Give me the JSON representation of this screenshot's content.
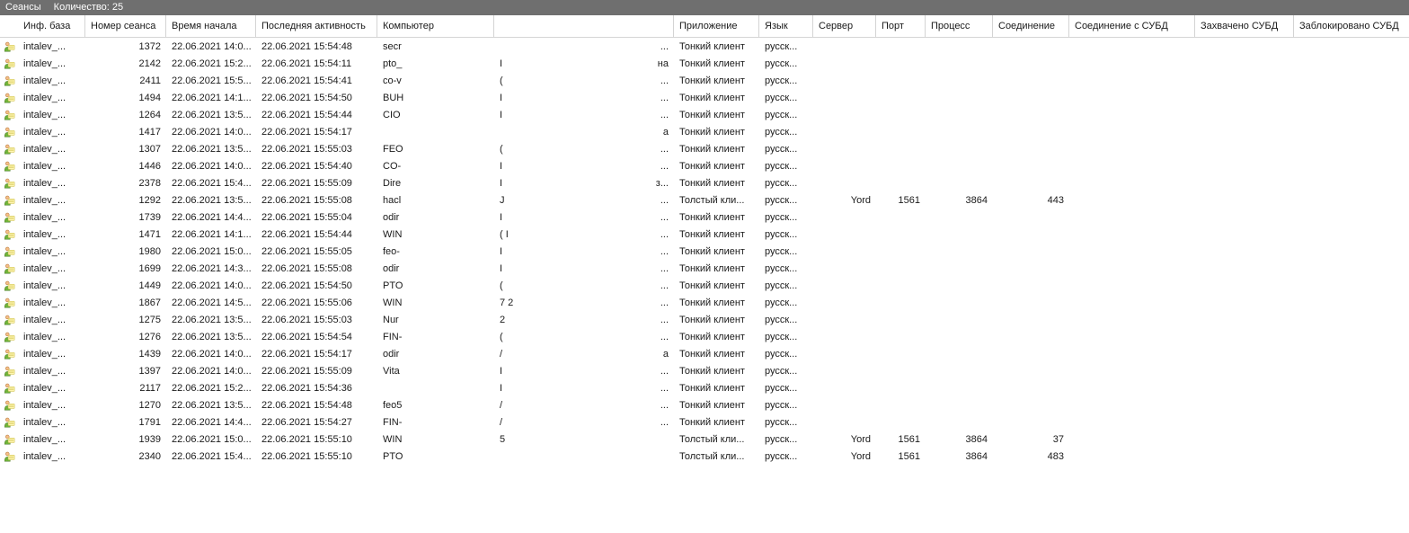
{
  "titlebar": {
    "title": "Сеансы",
    "count_label": "Количество: 25"
  },
  "headers": {
    "ib": "Инф. база",
    "num": "Номер сеанса",
    "start": "Время начала",
    "last": "Последняя активность",
    "comp": "Компьютер",
    "gap": "",
    "app": "Приложение",
    "lang": "Язык",
    "srv": "Сервер",
    "port": "Порт",
    "proc": "Процесс",
    "conn": "Соединение",
    "connd": "Соединение с СУБД",
    "zah": "Захвачено СУБД",
    "blk": "Заблокировано СУБД"
  },
  "rows": [
    {
      "ib": "intalev_...",
      "num": "1372",
      "start": "22.06.2021 14:0...",
      "last": "22.06.2021 15:54:48",
      "comp": "secr",
      "g": "",
      "gt": "...",
      "app": "Тонкий клиент",
      "lang": "русск...",
      "srv": "",
      "port": "",
      "proc": "",
      "conn": ""
    },
    {
      "ib": "intalev_...",
      "num": "2142",
      "start": "22.06.2021 15:2...",
      "last": "22.06.2021 15:54:11",
      "comp": "pto_",
      "g": "I",
      "gt": "на",
      "app": "Тонкий клиент",
      "lang": "русск...",
      "srv": "",
      "port": "",
      "proc": "",
      "conn": ""
    },
    {
      "ib": "intalev_...",
      "num": "2411",
      "start": "22.06.2021 15:5...",
      "last": "22.06.2021 15:54:41",
      "comp": "co-v",
      "g": "(",
      "gt": "...",
      "app": "Тонкий клиент",
      "lang": "русск...",
      "srv": "",
      "port": "",
      "proc": "",
      "conn": ""
    },
    {
      "ib": "intalev_...",
      "num": "1494",
      "start": "22.06.2021 14:1...",
      "last": "22.06.2021 15:54:50",
      "comp": "BUH",
      "g": "I",
      "gt": "...",
      "app": "Тонкий клиент",
      "lang": "русск...",
      "srv": "",
      "port": "",
      "proc": "",
      "conn": ""
    },
    {
      "ib": "intalev_...",
      "num": "1264",
      "start": "22.06.2021 13:5...",
      "last": "22.06.2021 15:54:44",
      "comp": "CIO",
      "g": "I",
      "gt": "...",
      "app": "Тонкий клиент",
      "lang": "русск...",
      "srv": "",
      "port": "",
      "proc": "",
      "conn": ""
    },
    {
      "ib": "intalev_...",
      "num": "1417",
      "start": "22.06.2021 14:0...",
      "last": "22.06.2021 15:54:17",
      "comp": "",
      "g": "",
      "gt": "а",
      "app": "Тонкий клиент",
      "lang": "русск...",
      "srv": "",
      "port": "",
      "proc": "",
      "conn": ""
    },
    {
      "ib": "intalev_...",
      "num": "1307",
      "start": "22.06.2021 13:5...",
      "last": "22.06.2021 15:55:03",
      "comp": "FEO",
      "g": "(",
      "gt": "...",
      "app": "Тонкий клиент",
      "lang": "русск...",
      "srv": "",
      "port": "",
      "proc": "",
      "conn": ""
    },
    {
      "ib": "intalev_...",
      "num": "1446",
      "start": "22.06.2021 14:0...",
      "last": "22.06.2021 15:54:40",
      "comp": "CO-",
      "g": "I",
      "gt": "...",
      "app": "Тонкий клиент",
      "lang": "русск...",
      "srv": "",
      "port": "",
      "proc": "",
      "conn": ""
    },
    {
      "ib": "intalev_...",
      "num": "2378",
      "start": "22.06.2021 15:4...",
      "last": "22.06.2021 15:55:09",
      "comp": "Dire",
      "g": "I",
      "gt": "з...",
      "app": "Тонкий клиент",
      "lang": "русск...",
      "srv": "",
      "port": "",
      "proc": "",
      "conn": ""
    },
    {
      "ib": "intalev_...",
      "num": "1292",
      "start": "22.06.2021 13:5...",
      "last": "22.06.2021 15:55:08",
      "comp": "hacl",
      "g": "J",
      "gt": "...",
      "app": "Толстый кли...",
      "lang": "русск...",
      "srv": "Yord",
      "port": "1561",
      "proc": "3864",
      "conn": "443"
    },
    {
      "ib": "intalev_...",
      "num": "1739",
      "start": "22.06.2021 14:4...",
      "last": "22.06.2021 15:55:04",
      "comp": "odir",
      "g": "I",
      "gt": "...",
      "app": "Тонкий клиент",
      "lang": "русск...",
      "srv": "",
      "port": "",
      "proc": "",
      "conn": ""
    },
    {
      "ib": "intalev_...",
      "num": "1471",
      "start": "22.06.2021 14:1...",
      "last": "22.06.2021 15:54:44",
      "comp": "WIN",
      "g": "(   I",
      "gt": "...",
      "app": "Тонкий клиент",
      "lang": "русск...",
      "srv": "",
      "port": "",
      "proc": "",
      "conn": ""
    },
    {
      "ib": "intalev_...",
      "num": "1980",
      "start": "22.06.2021 15:0...",
      "last": "22.06.2021 15:55:05",
      "comp": "feo-",
      "g": "I",
      "gt": "...",
      "app": "Тонкий клиент",
      "lang": "русск...",
      "srv": "",
      "port": "",
      "proc": "",
      "conn": ""
    },
    {
      "ib": "intalev_...",
      "num": "1699",
      "start": "22.06.2021 14:3...",
      "last": "22.06.2021 15:55:08",
      "comp": "odir",
      "g": "I",
      "gt": "...",
      "app": "Тонкий клиент",
      "lang": "русск...",
      "srv": "",
      "port": "",
      "proc": "",
      "conn": ""
    },
    {
      "ib": "intalev_...",
      "num": "1449",
      "start": "22.06.2021 14:0...",
      "last": "22.06.2021 15:54:50",
      "comp": "PTO",
      "g": "(",
      "gt": "...",
      "app": "Тонкий клиент",
      "lang": "русск...",
      "srv": "",
      "port": "",
      "proc": "",
      "conn": ""
    },
    {
      "ib": "intalev_...",
      "num": "1867",
      "start": "22.06.2021 14:5...",
      "last": "22.06.2021 15:55:06",
      "comp": "WIN",
      "g": "7   2",
      "gt": "...",
      "app": "Тонкий клиент",
      "lang": "русск...",
      "srv": "",
      "port": "",
      "proc": "",
      "conn": ""
    },
    {
      "ib": "intalev_...",
      "num": "1275",
      "start": "22.06.2021 13:5...",
      "last": "22.06.2021 15:55:03",
      "comp": "Nur",
      "g": "2",
      "gt": "...",
      "app": "Тонкий клиент",
      "lang": "русск...",
      "srv": "",
      "port": "",
      "proc": "",
      "conn": ""
    },
    {
      "ib": "intalev_...",
      "num": "1276",
      "start": "22.06.2021 13:5...",
      "last": "22.06.2021 15:54:54",
      "comp": "FIN-",
      "g": "(",
      "gt": "...",
      "app": "Тонкий клиент",
      "lang": "русск...",
      "srv": "",
      "port": "",
      "proc": "",
      "conn": ""
    },
    {
      "ib": "intalev_...",
      "num": "1439",
      "start": "22.06.2021 14:0...",
      "last": "22.06.2021 15:54:17",
      "comp": "odir",
      "g": "/",
      "gt": "а",
      "app": "Тонкий клиент",
      "lang": "русск...",
      "srv": "",
      "port": "",
      "proc": "",
      "conn": ""
    },
    {
      "ib": "intalev_...",
      "num": "1397",
      "start": "22.06.2021 14:0...",
      "last": "22.06.2021 15:55:09",
      "comp": "Vita",
      "g": "I",
      "gt": "...",
      "app": "Тонкий клиент",
      "lang": "русск...",
      "srv": "",
      "port": "",
      "proc": "",
      "conn": ""
    },
    {
      "ib": "intalev_...",
      "num": "2117",
      "start": "22.06.2021 15:2...",
      "last": "22.06.2021 15:54:36",
      "comp": "",
      "g": "I",
      "gt": "...",
      "app": "Тонкий клиент",
      "lang": "русск...",
      "srv": "",
      "port": "",
      "proc": "",
      "conn": ""
    },
    {
      "ib": "intalev_...",
      "num": "1270",
      "start": "22.06.2021 13:5...",
      "last": "22.06.2021 15:54:48",
      "comp": "feo5",
      "g": "/",
      "gt": "...",
      "app": "Тонкий клиент",
      "lang": "русск...",
      "srv": "",
      "port": "",
      "proc": "",
      "conn": ""
    },
    {
      "ib": "intalev_...",
      "num": "1791",
      "start": "22.06.2021 14:4...",
      "last": "22.06.2021 15:54:27",
      "comp": "FIN-",
      "g": "/",
      "gt": "...",
      "app": "Тонкий клиент",
      "lang": "русск...",
      "srv": "",
      "port": "",
      "proc": "",
      "conn": ""
    },
    {
      "ib": "intalev_...",
      "num": "1939",
      "start": "22.06.2021 15:0...",
      "last": "22.06.2021 15:55:10",
      "comp": "WIN",
      "g": "5",
      "gt": "",
      "app": "Толстый кли...",
      "lang": "русск...",
      "srv": "Yord",
      "port": "1561",
      "proc": "3864",
      "conn": "37"
    },
    {
      "ib": "intalev_...",
      "num": "2340",
      "start": "22.06.2021 15:4...",
      "last": "22.06.2021 15:55:10",
      "comp": "PTO",
      "g": "",
      "gt": "",
      "app": "Толстый кли...",
      "lang": "русск...",
      "srv": "Yord",
      "port": "1561",
      "proc": "3864",
      "conn": "483"
    }
  ]
}
